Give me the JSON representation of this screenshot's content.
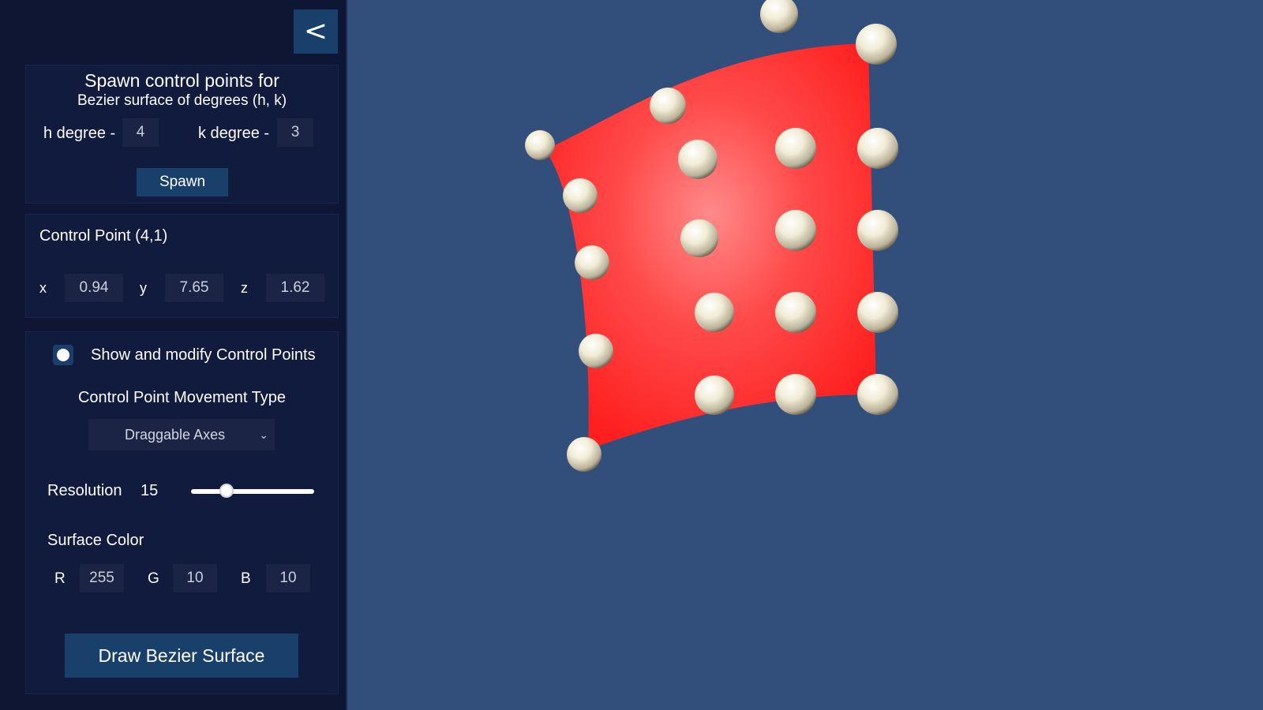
{
  "panel": {
    "collapse_label": "<",
    "spawn": {
      "title": "Spawn control points for",
      "subtitle": "Bezier surface of degrees (h, k)",
      "h_label": "h degree -",
      "h_value": "4",
      "k_label": "k degree -",
      "k_value": "3",
      "button_label": "Spawn"
    },
    "control_point": {
      "title": "Control Point (4,1)",
      "x_label": "x",
      "x_value": "0.94",
      "y_label": "y",
      "y_value": "7.65",
      "z_label": "z",
      "z_value": "1.62"
    },
    "options": {
      "toggle_label": "Show and modify Control Points",
      "toggle_on": true,
      "movement_title": "Control Point Movement Type",
      "movement_selected": "Draggable Axes",
      "resolution_label": "Resolution",
      "resolution_value": "15",
      "resolution_fraction": 0.28,
      "color_title": "Surface Color",
      "r_label": "R",
      "r_value": "255",
      "g_label": "G",
      "g_value": "10",
      "b_label": "B",
      "b_value": "10",
      "draw_label": "Draw Bezier Surface"
    }
  },
  "colors": {
    "background": "#324f7c",
    "panel": "#0f1634",
    "accent": "#19406b",
    "surface": "#ff0a0a"
  }
}
